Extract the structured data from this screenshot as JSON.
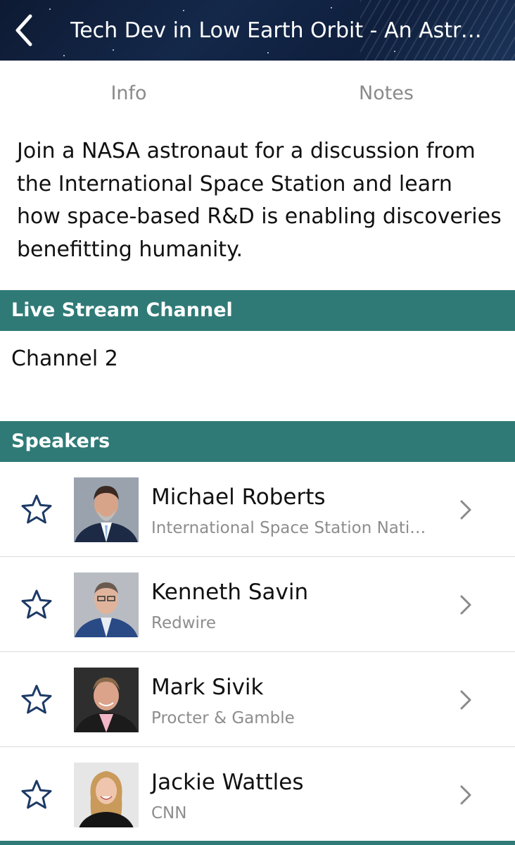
{
  "header": {
    "title": "Tech Dev in Low Earth Orbit - An Astronaut's Perspective",
    "back_icon": "chevron-left-icon"
  },
  "tabs": [
    {
      "label": "Info"
    },
    {
      "label": "Notes"
    }
  ],
  "description": "Join a NASA astronaut for a discussion from the International Space Station and learn how space-based R&D is enabling discoveries benefitting humanity.",
  "live_stream": {
    "heading": "Live Stream Channel",
    "value": "Channel 2"
  },
  "speakers_section": {
    "heading": "Speakers"
  },
  "speakers": [
    {
      "name": "Michael Roberts",
      "org": "International Space Station National Laboratory",
      "favorite_icon": "star-outline-icon"
    },
    {
      "name": "Kenneth Savin",
      "org": "Redwire",
      "favorite_icon": "star-outline-icon"
    },
    {
      "name": "Mark Sivik",
      "org": "Procter & Gamble",
      "favorite_icon": "star-outline-icon"
    },
    {
      "name": "Jackie Wattles",
      "org": "CNN",
      "favorite_icon": "star-outline-icon"
    }
  ],
  "colors": {
    "accent": "#2f7a77",
    "icon_blue": "#1d3a66",
    "header_bg": "#14284a",
    "muted_text": "#8d8d8d"
  }
}
